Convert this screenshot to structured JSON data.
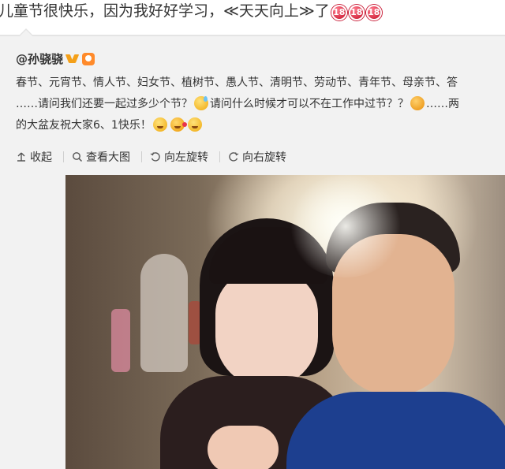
{
  "top_post": {
    "text": "儿童节很快乐，因为我好好学习，≪天天向上≫了",
    "badges": [
      "18",
      "18",
      "18"
    ]
  },
  "repost": {
    "author": "@孙骁骁",
    "author_icons": [
      "verified-v-icon",
      "level-icon"
    ],
    "lines": [
      "春节、元宵节、情人节、妇女节、植树节、愚人节、清明节、劳动节、青年节、母亲节、答",
      "……请问我们还要一起过多少个节？",
      "请问什么时候才可以不在工作中过节？？",
      "……两",
      "的大盆友祝大家6、1快乐！"
    ],
    "actions": {
      "collapse": "收起",
      "view_large": "查看大图",
      "rotate_left": "向左旋转",
      "rotate_right": "向右旋转"
    }
  },
  "colors": {
    "background": "#ffffff",
    "repost_background": "#f2f2f2",
    "badge": "#d0243c",
    "verified": "#f4a019"
  }
}
